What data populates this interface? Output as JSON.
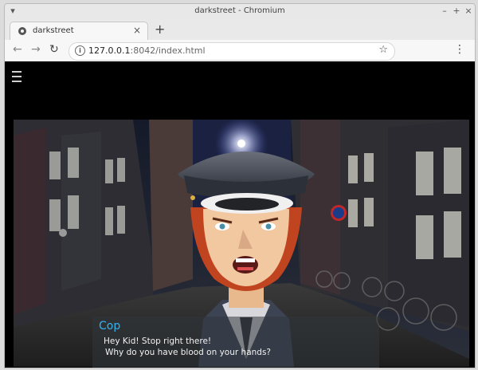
{
  "window": {
    "title": "darkstreet - Chromium"
  },
  "tab": {
    "label": "darkstreet",
    "close": "×"
  },
  "newtab": "+",
  "nav": {
    "back": "←",
    "forward": "→",
    "reload": "↻",
    "info": "i"
  },
  "address": {
    "host": "127.0.0.1",
    "rest": ":8042/index.html"
  },
  "star": "☆",
  "menu": "⋮",
  "wm": {
    "min": "–",
    "max": "+",
    "close": "×"
  },
  "dialog": {
    "speaker": "Cop",
    "line1": "Hey Kid! Stop right there!",
    "line2": "Why do you have blood on your hands?"
  },
  "colors": {
    "speaker": "#37b1ef",
    "background": "#000000"
  }
}
